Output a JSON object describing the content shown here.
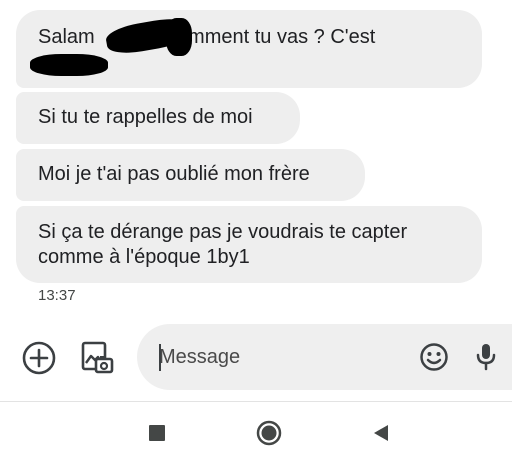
{
  "messages": [
    {
      "text": "Salam             comment tu vas ? C'est"
    },
    {
      "text": "Si tu te rappelles de moi"
    },
    {
      "text": "Moi je t'ai pas oublié mon frère"
    },
    {
      "text": "Si ça te dérange pas je voudrais te capter comme à l'époque 1by1"
    }
  ],
  "timestamp": "13:37",
  "composer": {
    "placeholder": "Message"
  },
  "icons": {
    "add": "add-circle-icon",
    "gallery": "gallery-camera-icon",
    "emoji": "emoji-icon",
    "mic": "microphone-icon",
    "recents": "square-icon",
    "home": "circle-icon",
    "back": "back-triangle-icon"
  },
  "colors": {
    "bubble": "#eeeeee",
    "composer": "#efefef",
    "text": "#202124",
    "icon": "#3c4043"
  }
}
